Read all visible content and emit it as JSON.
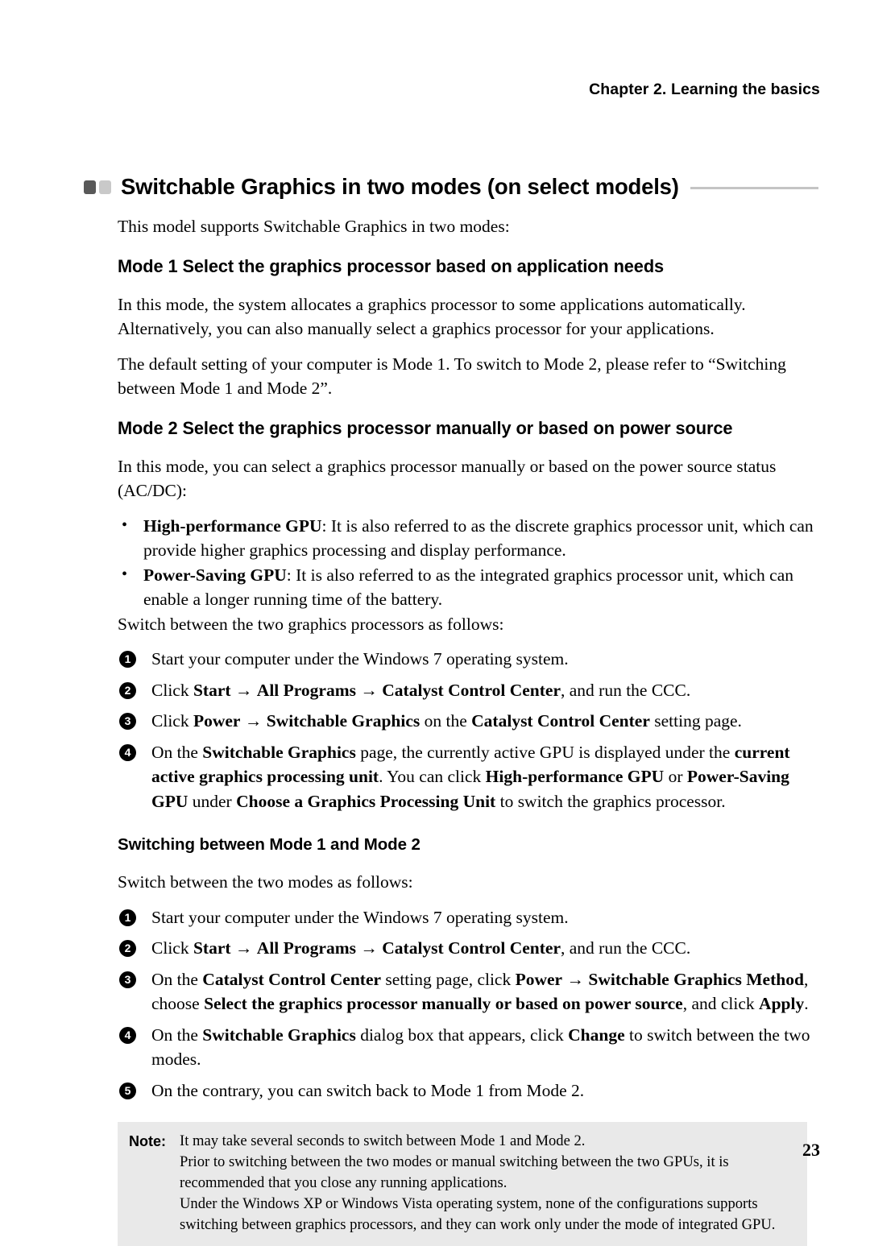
{
  "header": {
    "chapter": "Chapter 2. Learning the basics"
  },
  "section": {
    "title": "Switchable Graphics in two modes (on select models)",
    "intro": "This model supports Switchable Graphics in two modes:",
    "bullet_colors": {
      "dark": "#595959",
      "light": "#c9c9c9",
      "rule": "#c4c4c4"
    }
  },
  "mode1": {
    "heading": "Mode 1  Select the graphics processor based on application needs",
    "para1": "In this mode, the system allocates a graphics processor to some applications automatically. Alternatively, you can also manually select a graphics processor for your applications.",
    "para2": "The default setting of your computer is Mode 1. To switch to Mode 2, please refer to “Switching between Mode 1 and Mode 2”."
  },
  "mode2": {
    "heading": "Mode 2  Select the graphics processor manually or based on power source",
    "para1": "In this mode, you can select a graphics processor manually or based on the power source status (AC/DC):",
    "bullets": [
      {
        "term": "High-performance GPU",
        "text": ": It is also referred to as the discrete graphics processor unit, which can provide higher graphics processing and display performance."
      },
      {
        "term": "Power-Saving GPU",
        "text": ": It is also referred to as the integrated graphics processor unit, which can enable a longer running time of the battery."
      }
    ],
    "lead_in": "Switch between the two graphics processors as follows:",
    "steps": [
      {
        "num": "1",
        "parts": [
          {
            "t": "Start your computer under the Windows 7 operating system.",
            "b": false
          }
        ]
      },
      {
        "num": "2",
        "parts": [
          {
            "t": "Click ",
            "b": false
          },
          {
            "t": "Start",
            "b": true
          },
          {
            "t": " → ",
            "b": false
          },
          {
            "t": "All Programs",
            "b": true
          },
          {
            "t": " → ",
            "b": false
          },
          {
            "t": "Catalyst Control Center",
            "b": true
          },
          {
            "t": ", and run the CCC.",
            "b": false
          }
        ]
      },
      {
        "num": "3",
        "parts": [
          {
            "t": "Click ",
            "b": false
          },
          {
            "t": "Power",
            "b": true
          },
          {
            "t": " → ",
            "b": false
          },
          {
            "t": "Switchable Graphics",
            "b": true
          },
          {
            "t": " on the ",
            "b": false
          },
          {
            "t": "Catalyst Control Center",
            "b": true
          },
          {
            "t": " setting page.",
            "b": false
          }
        ]
      },
      {
        "num": "4",
        "parts": [
          {
            "t": "On the ",
            "b": false
          },
          {
            "t": "Switchable Graphics",
            "b": true
          },
          {
            "t": " page, the currently active GPU is displayed under the ",
            "b": false
          },
          {
            "t": "current active graphics processing unit",
            "b": true
          },
          {
            "t": ". You can click ",
            "b": false
          },
          {
            "t": "High-performance GPU",
            "b": true
          },
          {
            "t": " or ",
            "b": false
          },
          {
            "t": "Power-Saving GPU",
            "b": true
          },
          {
            "t": " under ",
            "b": false
          },
          {
            "t": "Choose a Graphics Processing Unit",
            "b": true
          },
          {
            "t": " to switch the graphics processor.",
            "b": false
          }
        ]
      }
    ]
  },
  "switching": {
    "heading": "Switching between Mode 1 and Mode 2",
    "lead_in": "Switch between the two modes as follows:",
    "steps": [
      {
        "num": "1",
        "parts": [
          {
            "t": "Start your computer under the Windows 7 operating system.",
            "b": false
          }
        ]
      },
      {
        "num": "2",
        "parts": [
          {
            "t": "Click ",
            "b": false
          },
          {
            "t": "Start",
            "b": true
          },
          {
            "t": " → ",
            "b": false
          },
          {
            "t": "All Programs",
            "b": true
          },
          {
            "t": " → ",
            "b": false
          },
          {
            "t": "Catalyst Control Center",
            "b": true
          },
          {
            "t": ", and run the CCC.",
            "b": false
          }
        ]
      },
      {
        "num": "3",
        "parts": [
          {
            "t": "On the ",
            "b": false
          },
          {
            "t": "Catalyst Control Center",
            "b": true
          },
          {
            "t": " setting page, click ",
            "b": false
          },
          {
            "t": "Power",
            "b": true
          },
          {
            "t": " → ",
            "b": false
          },
          {
            "t": "Switchable Graphics Method",
            "b": true
          },
          {
            "t": ", choose ",
            "b": false
          },
          {
            "t": "Select the graphics processor manually or based on power source",
            "b": true
          },
          {
            "t": ", and click ",
            "b": false
          },
          {
            "t": "Apply",
            "b": true
          },
          {
            "t": ".",
            "b": false
          }
        ]
      },
      {
        "num": "4",
        "parts": [
          {
            "t": "On the ",
            "b": false
          },
          {
            "t": "Switchable Graphics",
            "b": true
          },
          {
            "t": " dialog box that appears, click ",
            "b": false
          },
          {
            "t": "Change",
            "b": true
          },
          {
            "t": " to switch between the two modes.",
            "b": false
          }
        ]
      },
      {
        "num": "5",
        "parts": [
          {
            "t": "On the contrary, you can switch back to Mode 1 from Mode 2.",
            "b": false
          }
        ]
      }
    ]
  },
  "note": {
    "label": "Note:",
    "background": "#e9e9e9",
    "lines": [
      "It may take several seconds to switch between Mode 1 and Mode 2.",
      "Prior to switching between the two modes or manual switching between the two GPUs, it is recommended that you close any running applications.",
      "Under the Windows XP or Windows Vista operating system, none of the configurations supports switching between graphics processors, and they can work only under the mode of integrated GPU."
    ]
  },
  "footer": {
    "page_number": "23"
  }
}
